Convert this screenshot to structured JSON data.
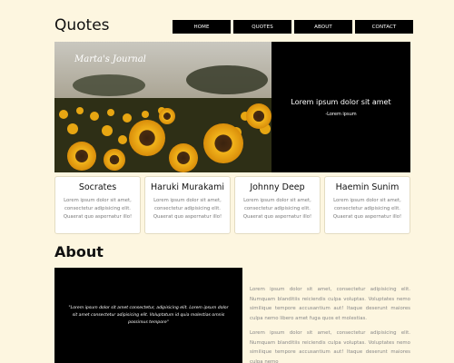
{
  "site": {
    "title": "Quotes"
  },
  "nav": {
    "items": [
      "HOME",
      "QUOTES",
      "ABOUT",
      "CONTACT"
    ]
  },
  "hero": {
    "journal_title": "Marta's Journal",
    "heading": "Lorem ipsum dolor sit amet",
    "subheading": "-Lorem ipsum"
  },
  "cards": [
    {
      "name": "Socrates",
      "text": "Lorem ipsum dolor sit amet, consectetur adipisicing elit. Quaerat quo aspernatur illo!"
    },
    {
      "name": "Haruki Murakami",
      "text": "Lorem ipsum dolor sit amet, consectetur adipisicing elit. Quaerat quo aspernatur illo!"
    },
    {
      "name": "Johnny Deep",
      "text": "Lorem ipsum dolor sit amet, consectetur adipisicing elit. Quaerat quo aspernatur illo!"
    },
    {
      "name": "Haemin Sunim",
      "text": "Lorem ipsum dolor sit amet, consectetur adipisicing elit. Quaerat quo aspernatur illo!"
    }
  ],
  "about": {
    "title": "About",
    "quote": "\"Lorem ipsum dolor sit amet consectetur, adipisicing elit. Lorem ipsum dolor sit amet consectetur adipisicing elit. Voluptatum id quia molestias omnis possimus tempore\"",
    "paragraphs": [
      "Lorem ipsum dolor sit amet, consectetur adipisicing elit. Numquam blanditiis reiciendis culpa voluptas. Voluptates nemo similique tempore accusantium aut! Itaque deserunt maiores culpa nemo libero amet fuga quos et molestias.",
      "Lorem ipsum dolor sit amet, consectetur adipisicing elit. Numquam blanditiis reiciendis culpa voluptas. Voluptates nemo similique tempore accusantium aut! Itaque deserunt maiores culpa nemo"
    ]
  },
  "colors": {
    "background": "#fdf6e0",
    "nav": "#000000",
    "panel": "#000000",
    "card_border": "#e3dcc2"
  }
}
